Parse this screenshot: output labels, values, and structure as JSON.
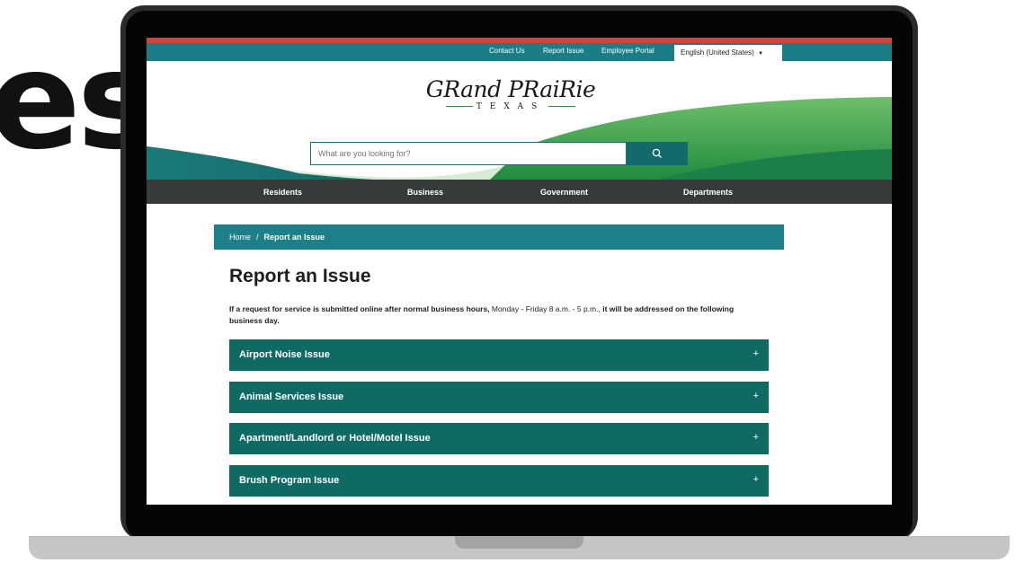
{
  "background_text": "es",
  "utility_bar": {
    "links": [
      "Contact Us",
      "Report Issue",
      "Employee Portal"
    ],
    "language": "English (United States)"
  },
  "logo": {
    "name": "GRand PRaiRie",
    "subtitle": "TEXAS"
  },
  "search": {
    "placeholder": "What are you looking for?",
    "icon": "search-icon"
  },
  "nav": {
    "items": [
      "Residents",
      "Business",
      "Government",
      "Departments"
    ]
  },
  "breadcrumb": {
    "home": "Home",
    "separator": "/",
    "current": "Report an Issue"
  },
  "page": {
    "title": "Report an Issue",
    "notice_bold_1": "If a request for service is submitted online after normal business hours,",
    "notice_hours": " Monday - Friday 8 a.m. - 5 p.m.,",
    "notice_bold_2": " it will be addressed on the following business day."
  },
  "accordion": {
    "items": [
      "Airport Noise Issue",
      "Animal Services Issue",
      "Apartment/Landlord or Hotel/Motel Issue",
      "Brush Program Issue"
    ],
    "expand_symbol": "+"
  },
  "colors": {
    "teal": "#1b7e86",
    "accordion": "#106a64",
    "nav": "#383a3a",
    "accent_red": "#c8463c"
  }
}
